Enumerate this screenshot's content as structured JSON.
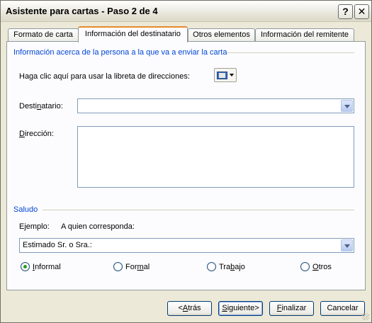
{
  "window": {
    "title": "Asistente para cartas - Paso 2 de 4",
    "help_label": "?",
    "close_label": "✕"
  },
  "tabs": [
    {
      "label": "Formato de carta",
      "active": false
    },
    {
      "label": "Información del destinatario",
      "active": true
    },
    {
      "label": "Otros elementos",
      "active": false
    },
    {
      "label": "Información del remitente",
      "active": false
    }
  ],
  "recipient": {
    "group_title": "Información acerca de la persona a la que va a enviar la carta",
    "address_book_label": "Haga clic aquí para usar la libreta de direcciones:",
    "address_book_icon": "address-book-icon",
    "recipient_label_pre": "Desti",
    "recipient_label_key": "n",
    "recipient_label_post": "atario:",
    "recipient_value": "",
    "address_label_key": "D",
    "address_label_post": "irección:",
    "address_value": ""
  },
  "salutation": {
    "group_title": "Saludo",
    "example_label": "Ejemplo:",
    "example_value": "A quien corresponda:",
    "combo_value": "Estimado Sr. o Sra.:",
    "options": [
      {
        "key": "I",
        "rest": "nformal",
        "checked": true
      },
      {
        "pre": "For",
        "key": "m",
        "rest": "al",
        "checked": false
      },
      {
        "pre": "Tra",
        "key": "b",
        "rest": "ajo",
        "checked": false
      },
      {
        "key": "O",
        "rest": "tros",
        "checked": false
      }
    ]
  },
  "buttons": {
    "back": {
      "pre": "<",
      "key": "A",
      "rest": "trás"
    },
    "next": {
      "key": "S",
      "rest": "iguiente>"
    },
    "finish": {
      "key": "F",
      "rest": "inalizar"
    },
    "cancel": "Cancelar"
  },
  "colors": {
    "group_title": "#0046d5",
    "active_tab_accent": "#e68b2c",
    "radio_checked": "#21a121"
  }
}
